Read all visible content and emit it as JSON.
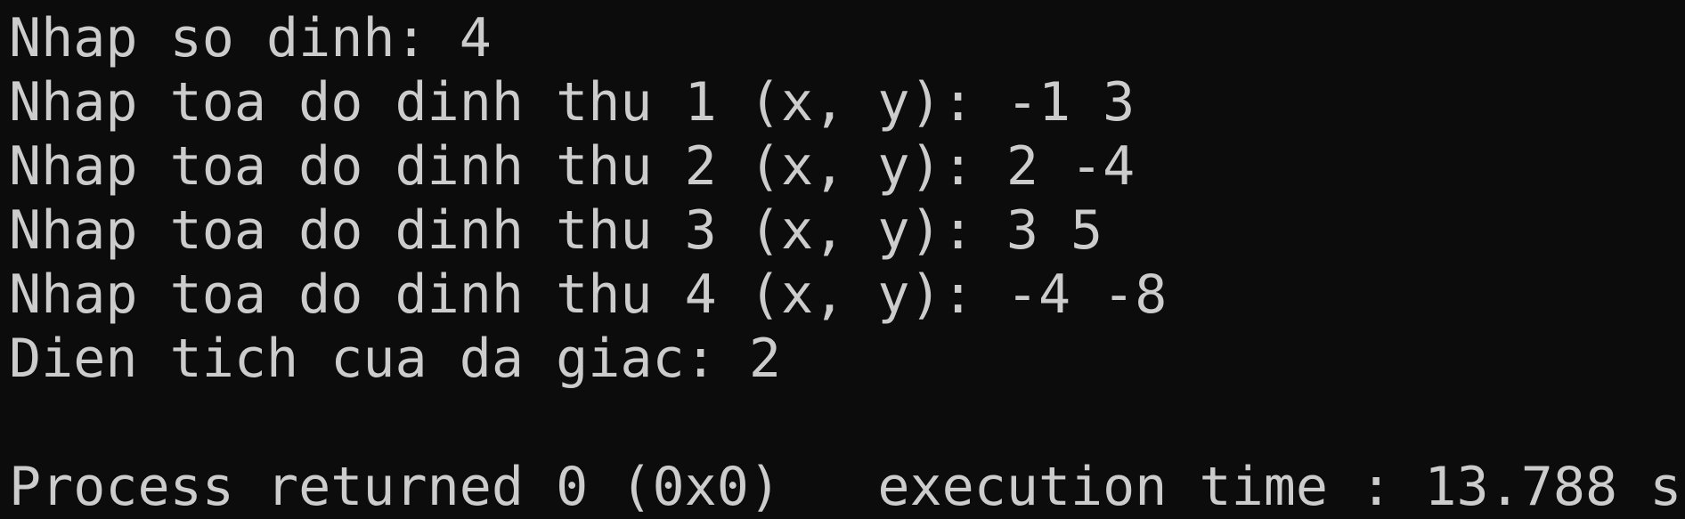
{
  "console": {
    "lines": [
      "Nhap so dinh: 4",
      "Nhap toa do dinh thu 1 (x, y): -1 3",
      "Nhap toa do dinh thu 2 (x, y): 2 -4",
      "Nhap toa do dinh thu 3 (x, y): 3 5",
      "Nhap toa do dinh thu 4 (x, y): -4 -8",
      "Dien tich cua da giac: 2",
      "",
      "Process returned 0 (0x0)   execution time : 13.788 s"
    ],
    "colors": {
      "background": "#0c0c0c",
      "text": "#cccccc"
    }
  }
}
